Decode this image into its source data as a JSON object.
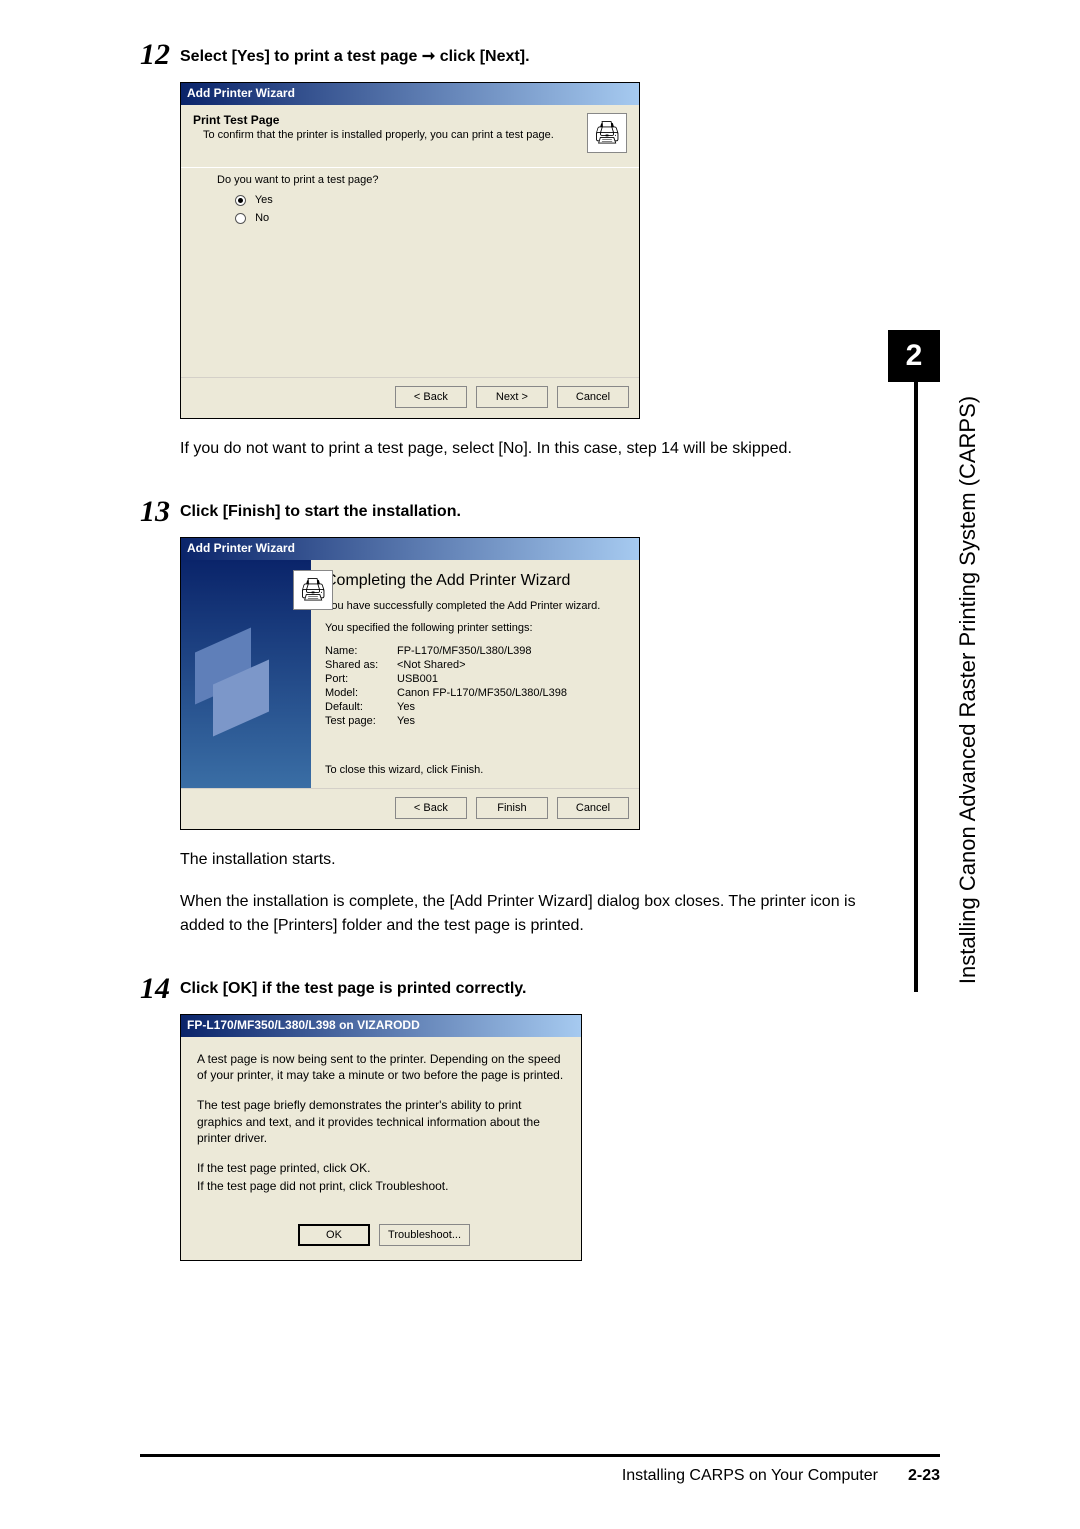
{
  "sidebar": {
    "chapter_number": "2",
    "chapter_title": "Installing Canon Advanced Raster Printing System (CARPS)"
  },
  "step12": {
    "number": "12",
    "title": "Select [Yes] to print a test page ➞ click [Next].",
    "dialog": {
      "window_title": "Add Printer Wizard",
      "header_title": "Print Test Page",
      "header_sub": "To confirm that the printer is installed properly, you can print a test page.",
      "question": "Do you want to print a test page?",
      "opt_yes": "Yes",
      "opt_no": "No",
      "btn_back": "< Back",
      "btn_next": "Next >",
      "btn_cancel": "Cancel"
    },
    "note": "If you do not want to print a test page, select [No]. In this case, step 14 will be skipped."
  },
  "step13": {
    "number": "13",
    "title": "Click [Finish] to start the installation.",
    "dialog": {
      "window_title": "Add Printer Wizard",
      "heading": "Completing the Add Printer Wizard",
      "line1": "You have successfully completed the Add Printer wizard.",
      "line2": "You specified the following printer settings:",
      "rows": {
        "name_k": "Name:",
        "name_v": "FP-L170/MF350/L380/L398",
        "shared_k": "Shared as:",
        "shared_v": "<Not Shared>",
        "port_k": "Port:",
        "port_v": "USB001",
        "model_k": "Model:",
        "model_v": "Canon FP-L170/MF350/L380/L398",
        "default_k": "Default:",
        "default_v": "Yes",
        "test_k": "Test page:",
        "test_v": "Yes"
      },
      "close_note": "To close this wizard, click Finish.",
      "btn_back": "< Back",
      "btn_finish": "Finish",
      "btn_cancel": "Cancel"
    },
    "note1": "The installation starts.",
    "note2": "When the installation is complete, the [Add Printer Wizard] dialog box closes. The printer icon is added to the [Printers] folder and the test page is printed."
  },
  "step14": {
    "number": "14",
    "title": "Click [OK] if the test page is printed correctly.",
    "dialog": {
      "window_title": "FP-L170/MF350/L380/L398 on VIZARODD",
      "p1": "A test page is now being sent to the printer. Depending on the speed of your printer, it may take a minute or two before the page is printed.",
      "p2": "The test page briefly demonstrates the printer's ability to print graphics and text, and it provides technical information about the printer driver.",
      "p3": "If the test page printed, click OK.",
      "p4": "If the test page did not print, click Troubleshoot.",
      "btn_ok": "OK",
      "btn_trouble": "Troubleshoot..."
    }
  },
  "footer": {
    "section": "Installing CARPS on Your Computer",
    "page": "2-23"
  }
}
